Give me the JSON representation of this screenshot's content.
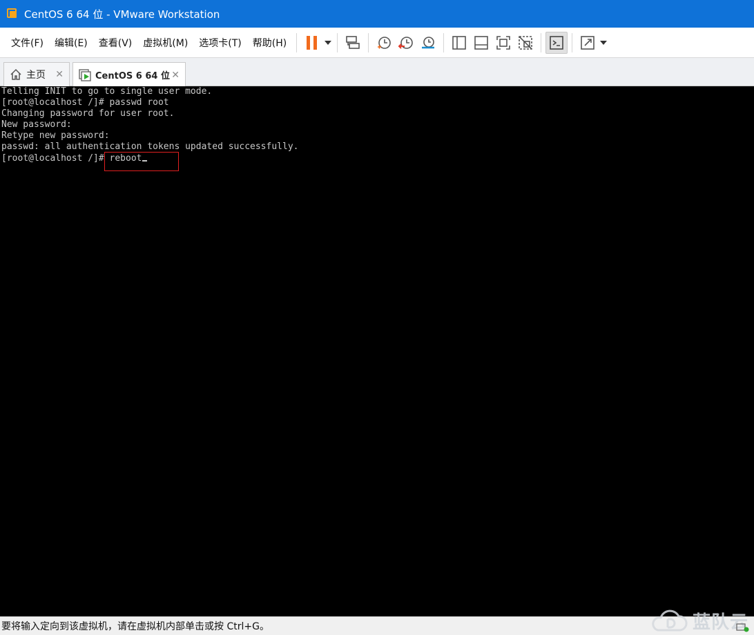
{
  "window": {
    "title": "CentOS 6 64 位 - VMware Workstation"
  },
  "menu": {
    "items": [
      {
        "label": "文件(F)"
      },
      {
        "label": "编辑(E)"
      },
      {
        "label": "查看(V)"
      },
      {
        "label": "虚拟机(M)"
      },
      {
        "label": "选项卡(T)"
      },
      {
        "label": "帮助(H)"
      }
    ]
  },
  "toolbar": {
    "icons": [
      "pause-icon",
      "chevron-down-icon",
      "send-ctrl-alt-del-icon",
      "snapshot-take-icon",
      "snapshot-revert-icon",
      "snapshot-manager-icon",
      "library-view-icon",
      "thumbnail-view-icon",
      "fullscreen-icon",
      "unity-icon",
      "console-view-icon",
      "stretch-guest-icon",
      "chevron-down-icon"
    ],
    "accent": "#f26b1d"
  },
  "tabs": [
    {
      "label": "主页",
      "icon": "home-icon",
      "active": false
    },
    {
      "label": "CentOS 6 64 位",
      "icon": "vm-running-icon",
      "active": true
    }
  ],
  "console": {
    "lines": [
      "Telling INIT to go to single user mode.",
      "[root@localhost /]# passwd root",
      "Changing password for user root.",
      "New password:",
      "Retype new password:",
      "passwd: all authentication tokens updated successfully.",
      "[root@localhost /]# reboot"
    ],
    "highlight_color": "#e02020"
  },
  "status": {
    "text": "要将输入定向到该虚拟机，请在虚拟机内部单击或按 Ctrl+G。"
  },
  "watermark": {
    "text": "蓝队云"
  },
  "colors": {
    "titlebar": "#0f72d8",
    "console_bg": "#000000"
  }
}
